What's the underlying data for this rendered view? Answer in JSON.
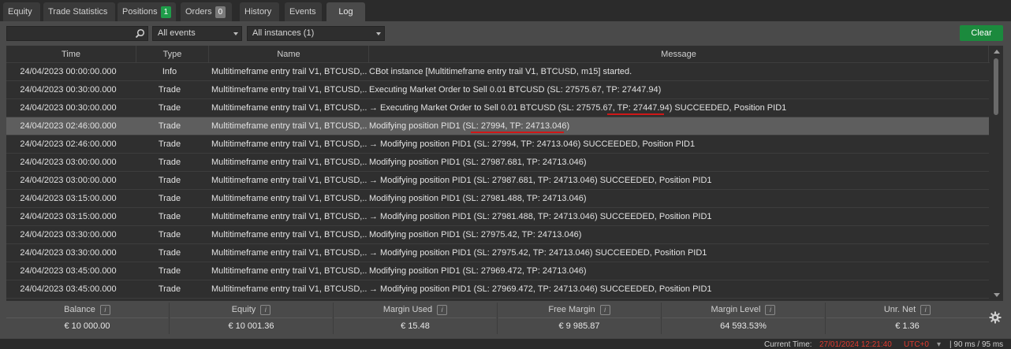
{
  "tabs": {
    "equity": "Equity",
    "trade_statistics": "Trade Statistics",
    "positions": "Positions",
    "positions_badge": "1",
    "orders": "Orders",
    "orders_badge": "0",
    "history": "History",
    "events": "Events",
    "log": "Log"
  },
  "toolbar": {
    "search_placeholder": "",
    "events_filter": "All events",
    "instances_filter": "All instances (1)",
    "clear_label": "Clear"
  },
  "table": {
    "headers": {
      "time": "Time",
      "type": "Type",
      "name": "Name",
      "message": "Message"
    },
    "rows": [
      {
        "time": "24/04/2023 00:00:00.000",
        "type": "Info",
        "name": "Multitimeframe entry trail V1, BTCUSD,...",
        "message": "CBot instance [Multitimeframe entry trail V1, BTCUSD, m15] started."
      },
      {
        "time": "24/04/2023 00:30:00.000",
        "type": "Trade",
        "name": "Multitimeframe entry trail V1, BTCUSD,...",
        "message": "Executing Market Order to Sell 0.01 BTCUSD (SL: 27575.67, TP: 27447.94)"
      },
      {
        "time": "24/04/2023 00:30:00.000",
        "type": "Trade",
        "name": "Multitimeframe entry trail V1, BTCUSD,...",
        "message": "→ Executing Market Order to Sell 0.01 BTCUSD (SL: 27575.67, TP: 27447.94) SUCCEEDED, Position PID1"
      },
      {
        "time": "24/04/2023 02:46:00.000",
        "type": "Trade",
        "name": "Multitimeframe entry trail V1, BTCUSD,...",
        "message": "Modifying position PID1 (SL: 27994, TP: 24713.046)"
      },
      {
        "time": "24/04/2023 02:46:00.000",
        "type": "Trade",
        "name": "Multitimeframe entry trail V1, BTCUSD,...",
        "message": "→ Modifying position PID1 (SL: 27994, TP: 24713.046) SUCCEEDED, Position PID1"
      },
      {
        "time": "24/04/2023 03:00:00.000",
        "type": "Trade",
        "name": "Multitimeframe entry trail V1, BTCUSD,...",
        "message": "Modifying position PID1 (SL: 27987.681, TP: 24713.046)"
      },
      {
        "time": "24/04/2023 03:00:00.000",
        "type": "Trade",
        "name": "Multitimeframe entry trail V1, BTCUSD,...",
        "message": "→ Modifying position PID1 (SL: 27987.681, TP: 24713.046) SUCCEEDED, Position PID1"
      },
      {
        "time": "24/04/2023 03:15:00.000",
        "type": "Trade",
        "name": "Multitimeframe entry trail V1, BTCUSD,...",
        "message": "Modifying position PID1 (SL: 27981.488, TP: 24713.046)"
      },
      {
        "time": "24/04/2023 03:15:00.000",
        "type": "Trade",
        "name": "Multitimeframe entry trail V1, BTCUSD,...",
        "message": "→ Modifying position PID1 (SL: 27981.488, TP: 24713.046) SUCCEEDED, Position PID1"
      },
      {
        "time": "24/04/2023 03:30:00.000",
        "type": "Trade",
        "name": "Multitimeframe entry trail V1, BTCUSD,...",
        "message": "Modifying position PID1 (SL: 27975.42, TP: 24713.046)"
      },
      {
        "time": "24/04/2023 03:30:00.000",
        "type": "Trade",
        "name": "Multitimeframe entry trail V1, BTCUSD,...",
        "message": "→ Modifying position PID1 (SL: 27975.42, TP: 24713.046) SUCCEEDED, Position PID1"
      },
      {
        "time": "24/04/2023 03:45:00.000",
        "type": "Trade",
        "name": "Multitimeframe entry trail V1, BTCUSD,...",
        "message": "Modifying position PID1 (SL: 27969.472, TP: 24713.046)"
      },
      {
        "time": "24/04/2023 03:45:00.000",
        "type": "Trade",
        "name": "Multitimeframe entry trail V1, BTCUSD,...",
        "message": "→ Modifying position PID1 (SL: 27969.472, TP: 24713.046) SUCCEEDED, Position PID1"
      }
    ],
    "selected_row": 3
  },
  "summary": {
    "balance_label": "Balance",
    "balance_value": "€ 10 000.00",
    "equity_label": "Equity",
    "equity_value": "€ 10 001.36",
    "margin_used_label": "Margin Used",
    "margin_used_value": "€ 15.48",
    "free_margin_label": "Free Margin",
    "free_margin_value": "€ 9 985.87",
    "margin_level_label": "Margin Level",
    "margin_level_value": "64 593.53%",
    "unr_net_label": "Unr. Net",
    "unr_net_value": "€ 1.36",
    "info_glyph": "i"
  },
  "status": {
    "current_time_label": "Current Time:",
    "current_time_value": "27/01/2024 12:21:40",
    "utc": "UTC+0",
    "caret": "▾",
    "ping": "| 90 ms / 95 ms"
  },
  "colors": {
    "accent_green": "#1b8a3d",
    "badge_positions": "#1f9d4a",
    "badge_orders": "#7a7a7a",
    "annotation_red": "#d01818",
    "status_red": "#e03a2e"
  }
}
